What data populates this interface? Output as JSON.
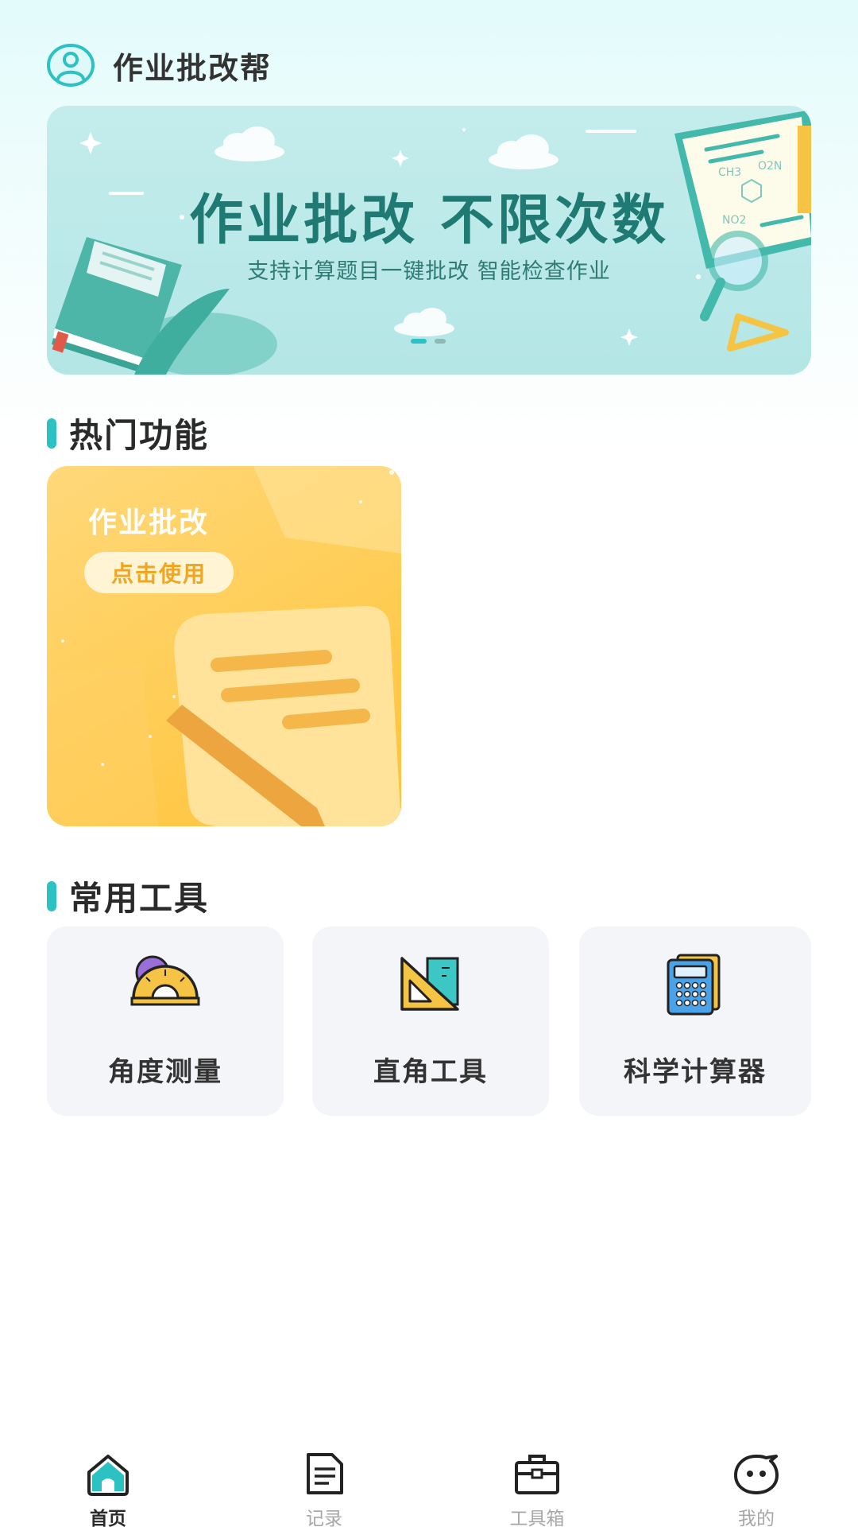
{
  "app": {
    "title": "作业批改帮"
  },
  "banner": {
    "title": "作业批改 不限次数",
    "subtitle": "支持计算题目一键批改 智能检查作业",
    "formula_labels": [
      "CH3",
      "O2N",
      "NO2"
    ]
  },
  "sections": {
    "hot": "热门功能",
    "tools": "常用工具"
  },
  "feature": {
    "title": "作业批改",
    "button_label": "点击使用"
  },
  "tools": [
    {
      "label": "角度测量",
      "icon": "protractor-icon"
    },
    {
      "label": "直角工具",
      "icon": "set-square-icon"
    },
    {
      "label": "科学计算器",
      "icon": "calculator-icon"
    }
  ],
  "nav": [
    {
      "label": "首页",
      "icon": "home-icon",
      "active": true
    },
    {
      "label": "记录",
      "icon": "document-icon",
      "active": false
    },
    {
      "label": "工具箱",
      "icon": "toolbox-icon",
      "active": false
    },
    {
      "label": "我的",
      "icon": "smiley-icon",
      "active": false
    }
  ],
  "colors": {
    "accent": "#2cc1c2",
    "banner_title": "#1f7a73",
    "feature_card": "#ffcd55",
    "feature_button_text": "#f1a520",
    "tool_card_bg": "#f4f5f8"
  }
}
